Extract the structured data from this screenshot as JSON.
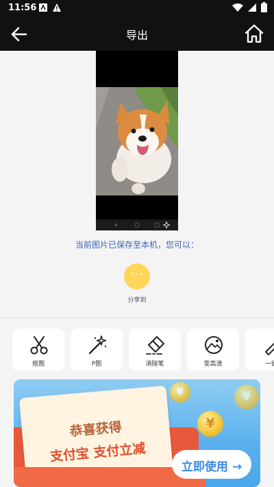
{
  "status": {
    "time": "11:56"
  },
  "appbar": {
    "title": "导出"
  },
  "message": "当前图片已保存至本机，您可以：",
  "share": {
    "label": "分享到",
    "glyph": "···",
    "color": "#ffd659"
  },
  "tools": [
    {
      "label": "抠图",
      "icon": "scissors-icon"
    },
    {
      "label": "P图",
      "icon": "magic-wand-icon"
    },
    {
      "label": "消除笔",
      "icon": "eraser-icon"
    },
    {
      "label": "变高清",
      "icon": "hd-enhance-icon"
    },
    {
      "label": "一键",
      "icon": "pen-icon"
    }
  ],
  "banner": {
    "line1": "恭喜获得",
    "line2": "支付宝 支付立减",
    "button": "立即使用 →",
    "coin_symbol": "¥",
    "bg_color": "#5ab0ee",
    "accent_color": "#e24d2c"
  },
  "colors": {
    "accent_text": "#3a63b8",
    "bar": "#111111"
  }
}
